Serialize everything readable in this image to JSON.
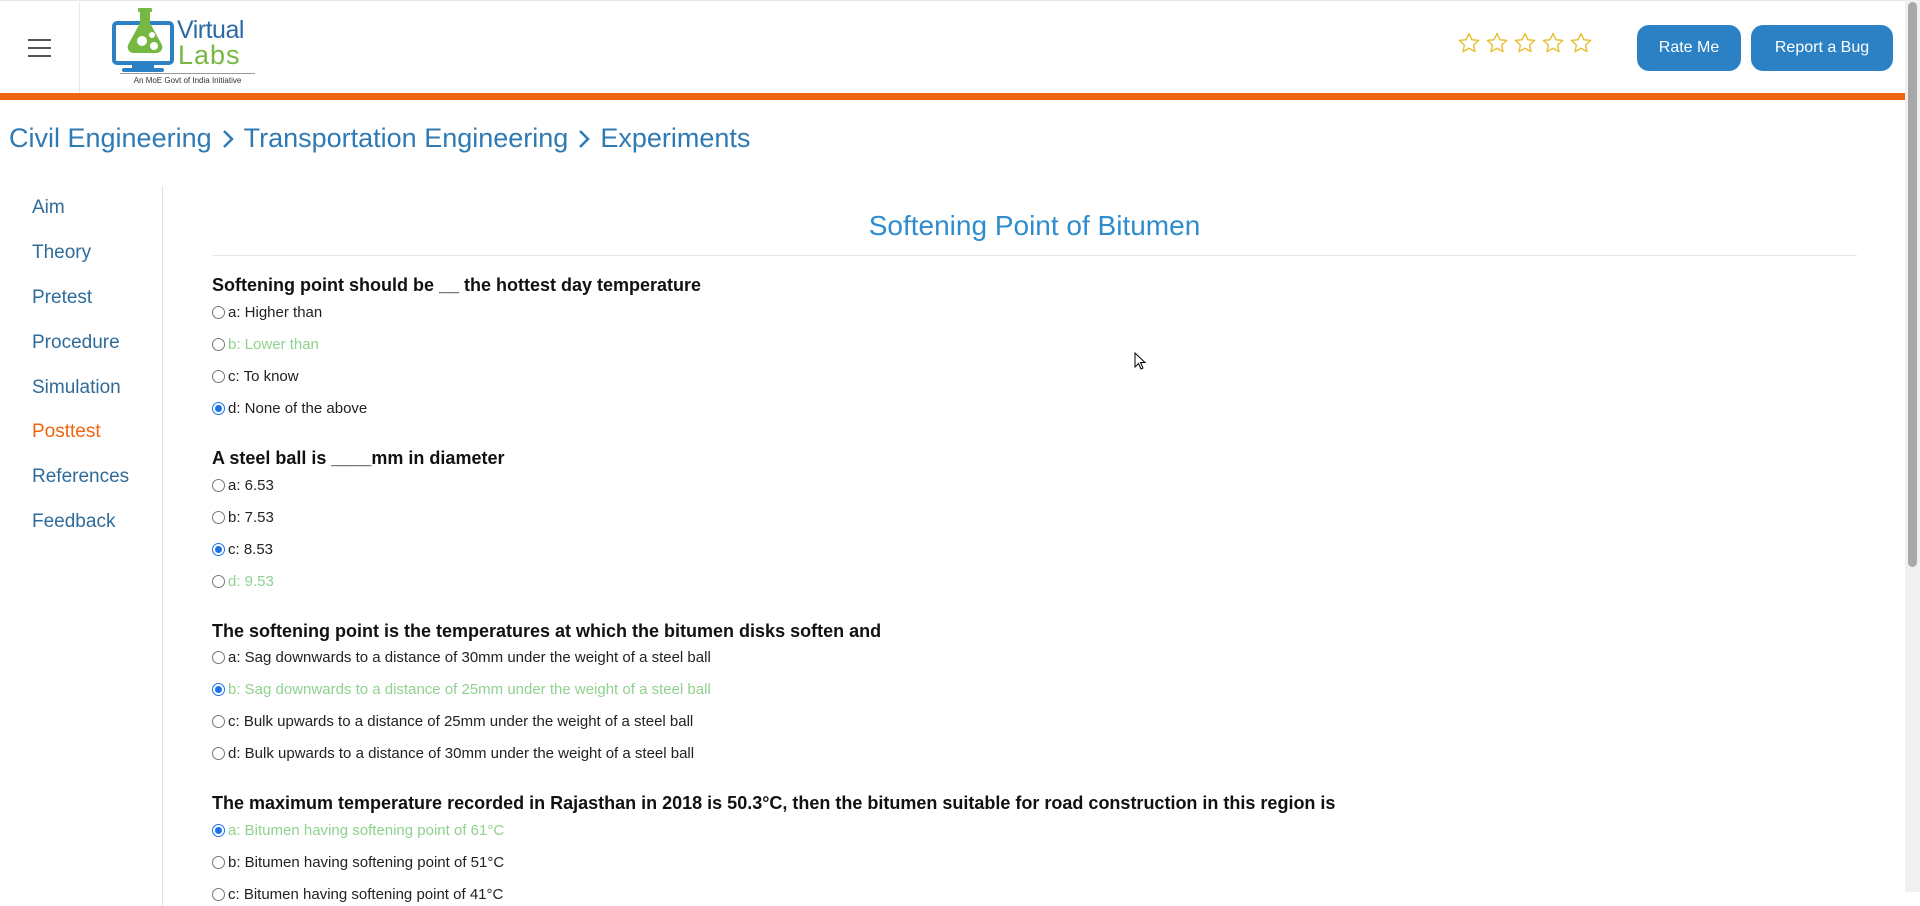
{
  "header": {
    "logo": {
      "word_virtual": "Virtual",
      "word_labs": "Labs",
      "tagline": "An MoE Govt of India Initiative"
    },
    "stars": {
      "rating": 0,
      "max": 5
    },
    "rate_label": "Rate Me",
    "bug_label": "Report a Bug",
    "accent_color": "#f0650f",
    "button_color": "#2b81c4"
  },
  "breadcrumb": {
    "items": [
      "Civil Engineering",
      "Transportation Engineering",
      "Experiments"
    ]
  },
  "sidebar": {
    "items": [
      {
        "label": "Aim"
      },
      {
        "label": "Theory"
      },
      {
        "label": "Pretest"
      },
      {
        "label": "Procedure"
      },
      {
        "label": "Simulation"
      },
      {
        "label": "Posttest",
        "active": true
      },
      {
        "label": "References"
      },
      {
        "label": "Feedback"
      }
    ]
  },
  "main": {
    "title": "Softening Point of Bitumen",
    "questions": [
      {
        "text": "Softening point should be __ the hottest day temperature",
        "options": [
          {
            "label": "a: Higher than",
            "checked": false,
            "correct": false
          },
          {
            "label": "b: Lower than",
            "checked": false,
            "correct": true
          },
          {
            "label": "c: To know",
            "checked": false,
            "correct": false
          },
          {
            "label": "d: None of the above",
            "checked": true,
            "correct": false
          }
        ]
      },
      {
        "text": "A steel ball is ____mm in diameter",
        "options": [
          {
            "label": "a: 6.53",
            "checked": false,
            "correct": false
          },
          {
            "label": "b: 7.53",
            "checked": false,
            "correct": false
          },
          {
            "label": "c: 8.53",
            "checked": true,
            "correct": false
          },
          {
            "label": "d: 9.53",
            "checked": false,
            "correct": true
          }
        ]
      },
      {
        "text": "The softening point is the temperatures at which the bitumen disks soften and",
        "options": [
          {
            "label": "a: Sag downwards to a distance of 30mm under the weight of a steel ball",
            "checked": false,
            "correct": false
          },
          {
            "label": "b: Sag downwards to a distance of 25mm under the weight of a steel ball",
            "checked": true,
            "correct": true
          },
          {
            "label": "c: Bulk upwards to a distance of 25mm under the weight of a steel ball",
            "checked": false,
            "correct": false
          },
          {
            "label": "d: Bulk upwards to a distance of 30mm under the weight of a steel ball",
            "checked": false,
            "correct": false
          }
        ]
      },
      {
        "text": "The maximum temperature recorded in Rajasthan in 2018 is 50.3°C, then the bitumen suitable for road construction in this region is",
        "options": [
          {
            "label": "a: Bitumen having softening point of 61°C",
            "checked": true,
            "correct": true
          },
          {
            "label": "b: Bitumen having softening point of 51°C",
            "checked": false,
            "correct": false
          },
          {
            "label": "c: Bitumen having softening point of 41°C",
            "checked": false,
            "correct": false
          }
        ]
      }
    ]
  }
}
